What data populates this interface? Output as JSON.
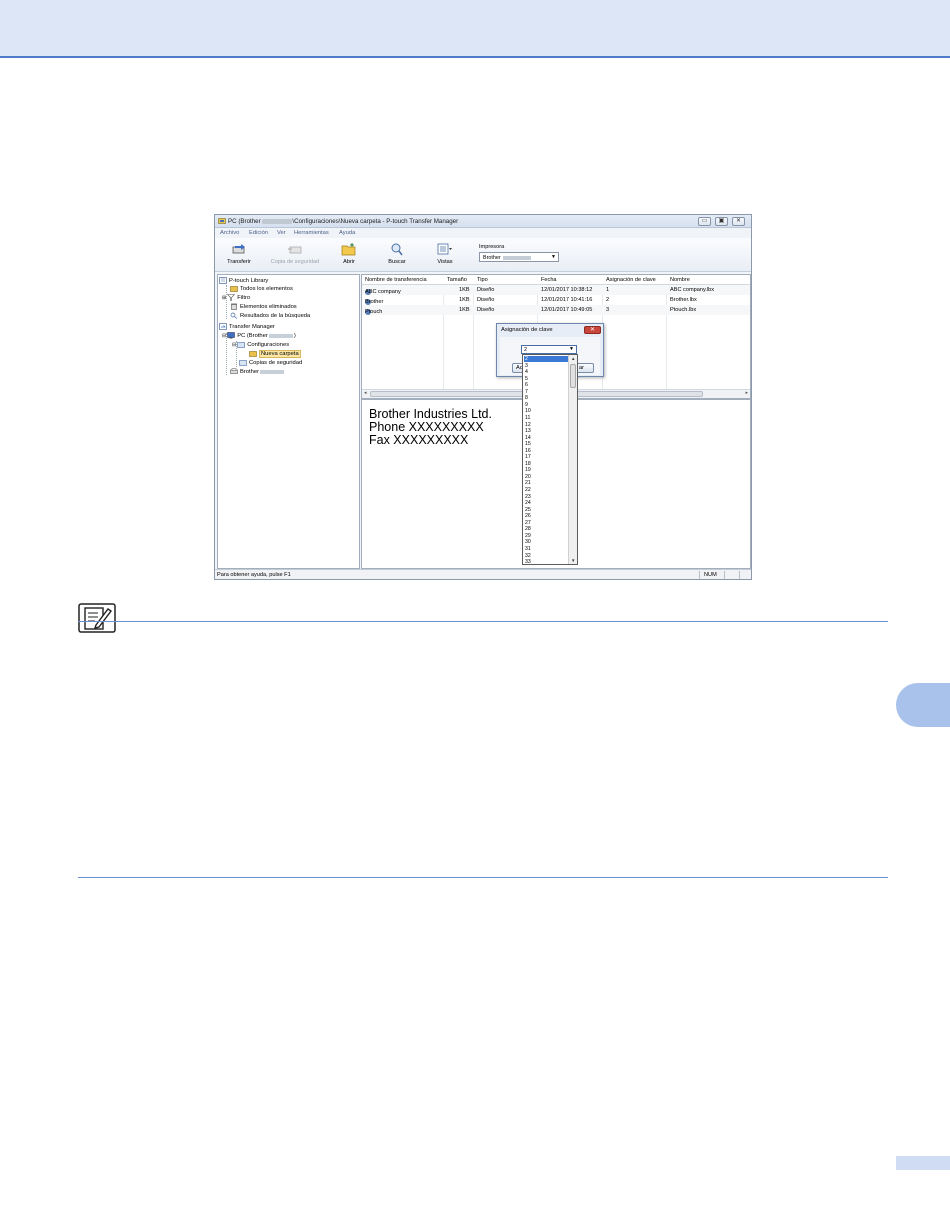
{
  "window": {
    "title_prefix": "PC (Brother",
    "title_suffix": "\\Configuraciones\\Nueva carpeta - P-touch Transfer Manager",
    "buttons": {
      "minimize": "▭",
      "maximize": "▣",
      "close": "✕"
    }
  },
  "menu": [
    "Archivo",
    "Edición",
    "Ver",
    "Herramientas",
    "Ayuda"
  ],
  "toolbar": {
    "transfer_label": "Transferir",
    "backup_label": "Copia de seguridad",
    "open_label": "Abrir",
    "search_label": "Buscar",
    "views_label": "Vistas",
    "printer_label": "Impresora",
    "printer_value": "Brother"
  },
  "tree": {
    "library": "P-touch Library",
    "all_items": "Todos los elementos",
    "filter": "Filtro",
    "deleted": "Elementos eliminados",
    "search_results": "Resultados de la búsqueda",
    "transfer_manager": "Transfer Manager",
    "pc_prefix": "PC (Brother",
    "pc_suffix": ")",
    "configurations": "Configuraciones",
    "new_folder": "Nueva carpeta",
    "backups": "Copias de seguridad",
    "brother": "Brother"
  },
  "list": {
    "headers": {
      "name": "Nombre de transferencia",
      "size": "Tamaño",
      "type": "Tipo",
      "date": "Fecha",
      "key": "Asignación de clave",
      "filename": "Nombre"
    },
    "rows": [
      {
        "name": "ABC company",
        "size": "1KB",
        "type": "Diseño",
        "date": "12/01/2017 10:38:12",
        "key": "1",
        "filename": "ABC company.lbx"
      },
      {
        "name": "Brother",
        "size": "1KB",
        "type": "Diseño",
        "date": "12/01/2017 10:41:16",
        "key": "2",
        "filename": "Brother.lbx"
      },
      {
        "name": "Ptouch",
        "size": "1KB",
        "type": "Diseño",
        "date": "12/01/2017 10:49:05",
        "key": "3",
        "filename": "Ptouch.lbx"
      }
    ]
  },
  "preview": {
    "line1": "Brother Industries Ltd.",
    "line2": "Phone XXXXXXXXX",
    "line3": "Fax XXXXXXXXX"
  },
  "dialog": {
    "title": "Asignación de clave",
    "close": "✕",
    "combo_value": "2",
    "ok_label": "Ac",
    "cancel_label": "ar",
    "options": [
      "2",
      "3",
      "4",
      "5",
      "6",
      "7",
      "8",
      "9",
      "10",
      "11",
      "12",
      "13",
      "14",
      "15",
      "16",
      "17",
      "18",
      "19",
      "20",
      "21",
      "22",
      "23",
      "24",
      "25",
      "26",
      "27",
      "28",
      "29",
      "30",
      "31",
      "32",
      "33"
    ]
  },
  "status": {
    "help": "Para obtener ayuda, pulse F1",
    "num": "NUM"
  }
}
